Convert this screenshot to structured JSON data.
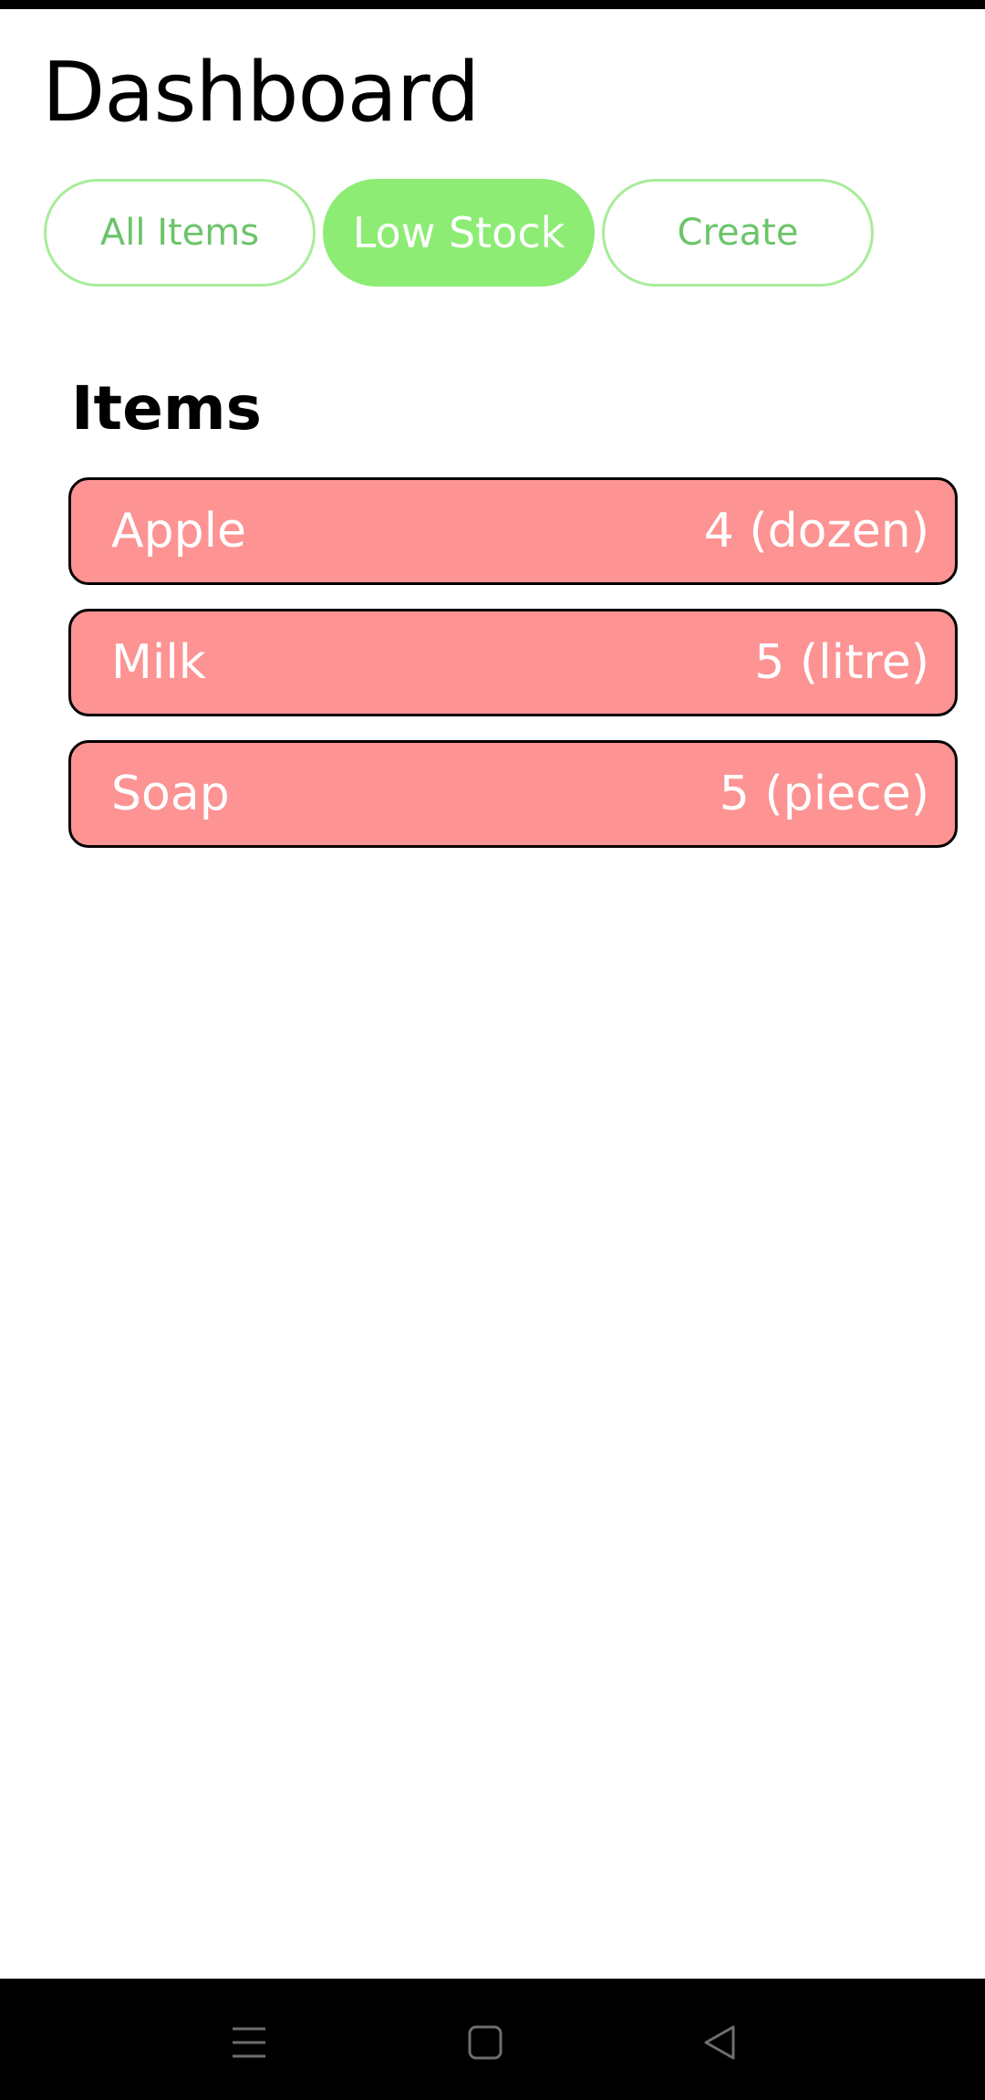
{
  "header": {
    "title": "Dashboard"
  },
  "tabs": [
    {
      "label": "All Items",
      "active": false
    },
    {
      "label": "Low Stock",
      "active": true
    },
    {
      "label": "Create",
      "active": false
    }
  ],
  "section": {
    "title": "Items"
  },
  "items": [
    {
      "name": "Apple",
      "quantity": "4 (dozen)"
    },
    {
      "name": "Milk",
      "quantity": "5 (litre)"
    },
    {
      "name": "Soap",
      "quantity": "5 (piece)"
    }
  ],
  "colors": {
    "accent_green": "#8cec74",
    "tab_border": "#a8ec9a",
    "low_stock_red": "#fd9393"
  },
  "nav": {
    "icons": [
      "menu-icon",
      "home-icon",
      "back-icon"
    ]
  }
}
